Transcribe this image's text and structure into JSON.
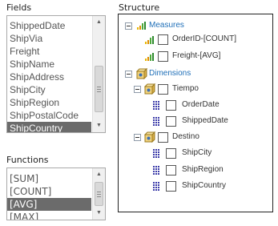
{
  "fields": {
    "label": "Fields",
    "items": [
      "ShippedDate",
      "ShipVia",
      "Freight",
      "ShipName",
      "ShipAddress",
      "ShipCity",
      "ShipRegion",
      "ShipPostalCode",
      "ShipCountry"
    ],
    "selected": "ShipCountry"
  },
  "functions": {
    "label": "Functions",
    "items": [
      "[SUM]",
      "[COUNT]",
      "[AVG]",
      "[MAX]"
    ],
    "selected": "[AVG]"
  },
  "structure": {
    "label": "Structure",
    "measures": {
      "label": "Measures",
      "icon": "measures-bar-icon",
      "children": [
        "OrderID-[COUNT]",
        "Freight-[AVG]"
      ]
    },
    "dimensions": {
      "label": "Dimensions",
      "icon": "dimension-cube-icon",
      "children": [
        {
          "label": "Tiempo",
          "levels": [
            "OrderDate",
            "ShippedDate"
          ]
        },
        {
          "label": "Destino",
          "levels": [
            "ShipCity",
            "ShipRegion",
            "ShipCountry"
          ]
        }
      ]
    }
  },
  "colors": {
    "selection": "#6b6b6b",
    "node_blue": "#1f6fb8",
    "level_icon": "#3a3aa8"
  }
}
